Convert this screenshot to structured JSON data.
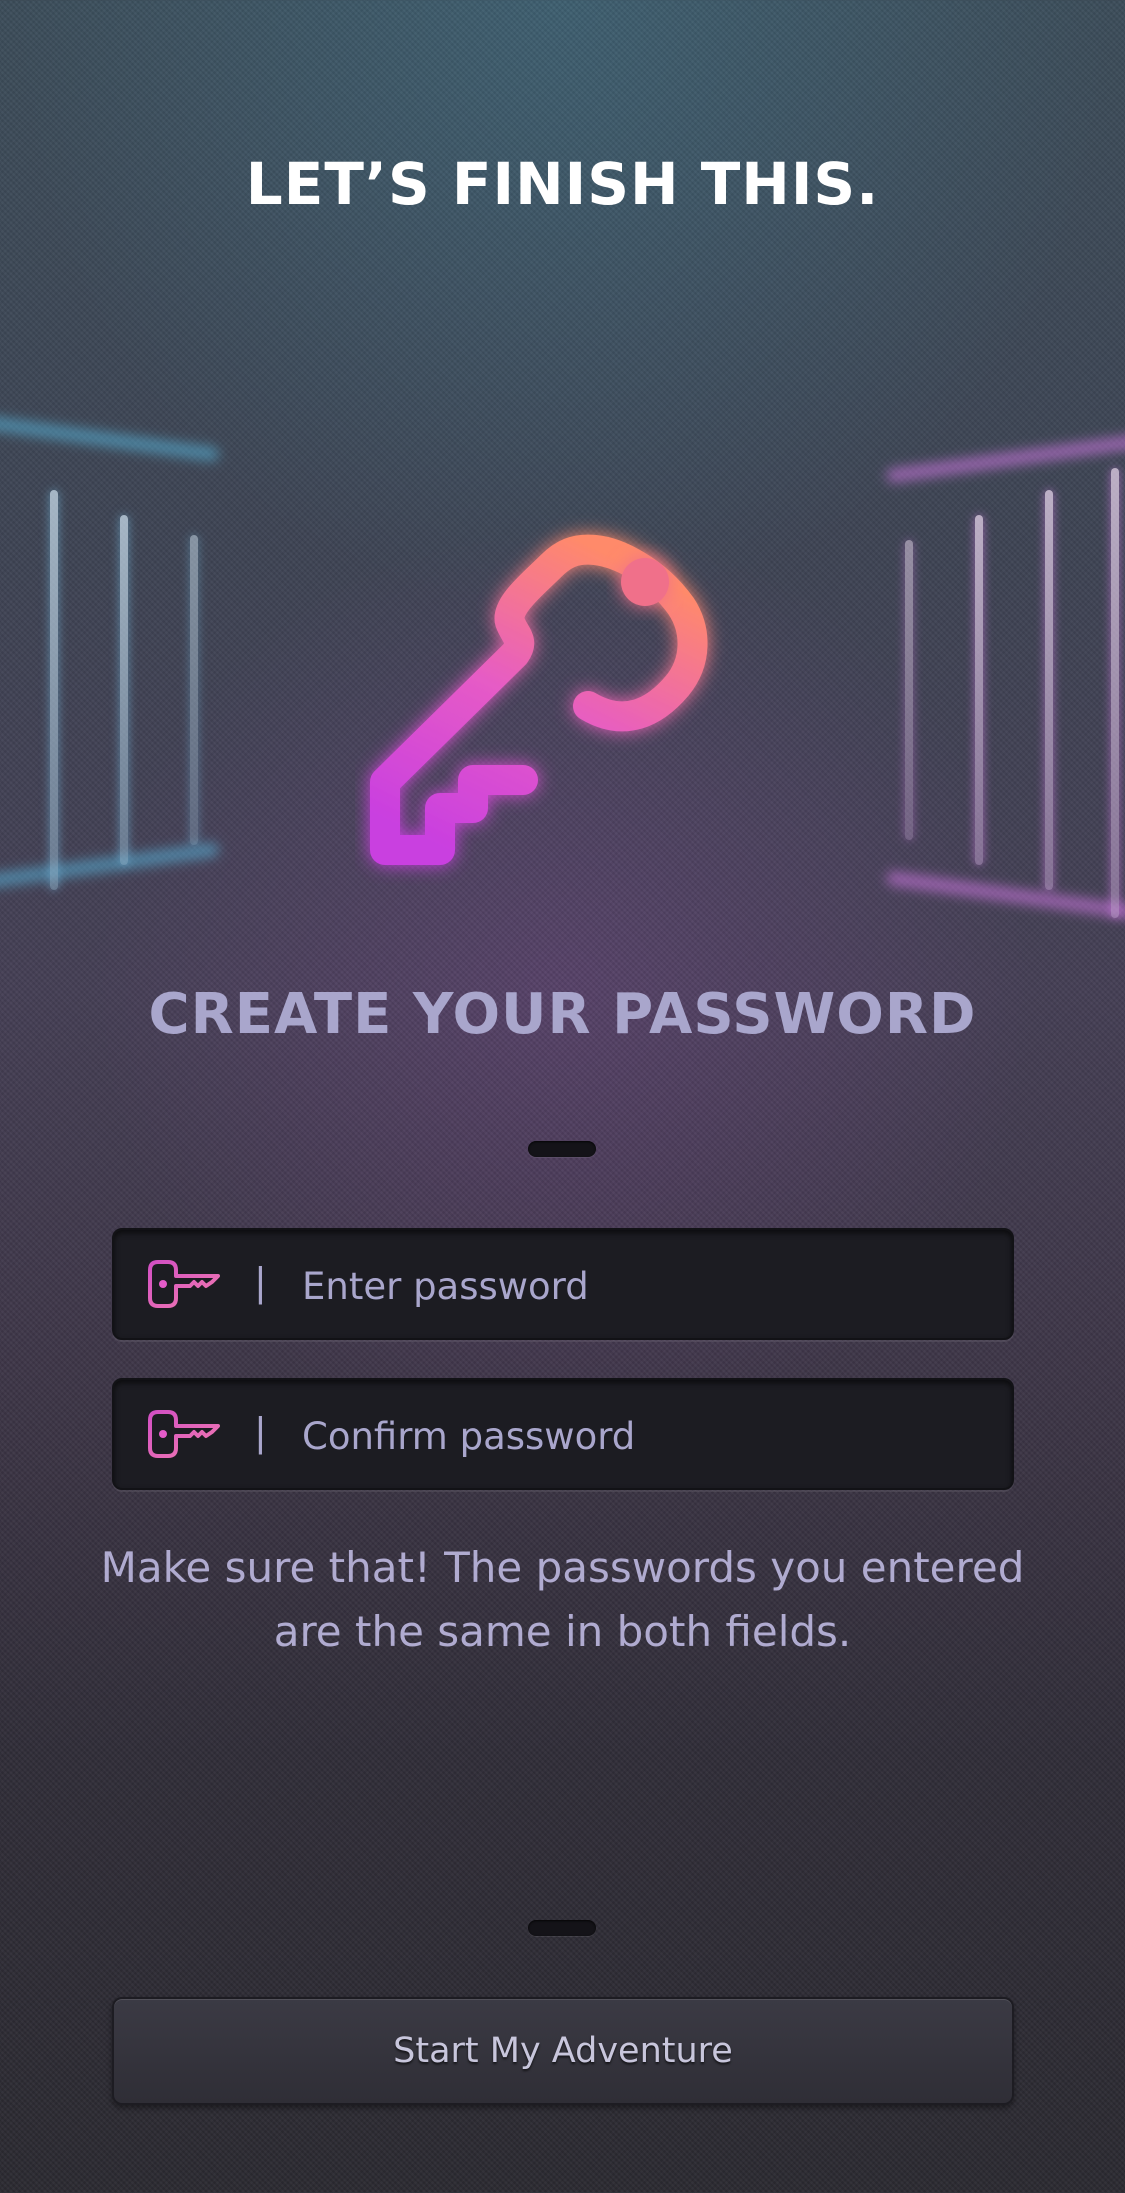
{
  "header": {
    "title": "LET’S FINISH THIS."
  },
  "hero": {
    "icon": "key-icon",
    "gradient": [
      "#ff8a6a",
      "#e05cc8",
      "#c93fe0"
    ]
  },
  "form": {
    "title": "CREATE YOUR PASSWORD",
    "password": {
      "placeholder": "Enter password",
      "value": "",
      "icon": "key-icon"
    },
    "confirm": {
      "placeholder": "Confirm password",
      "value": "",
      "icon": "key-icon"
    },
    "separator": "|",
    "hint": "Make sure that! The passwords you entered are the same in both fields."
  },
  "actions": {
    "submit_label": "Start My Adventure"
  },
  "colors": {
    "accent_pink": "#e45bc9",
    "subtitle": "#a9a6cc",
    "field_bg": "#1c1c22"
  }
}
